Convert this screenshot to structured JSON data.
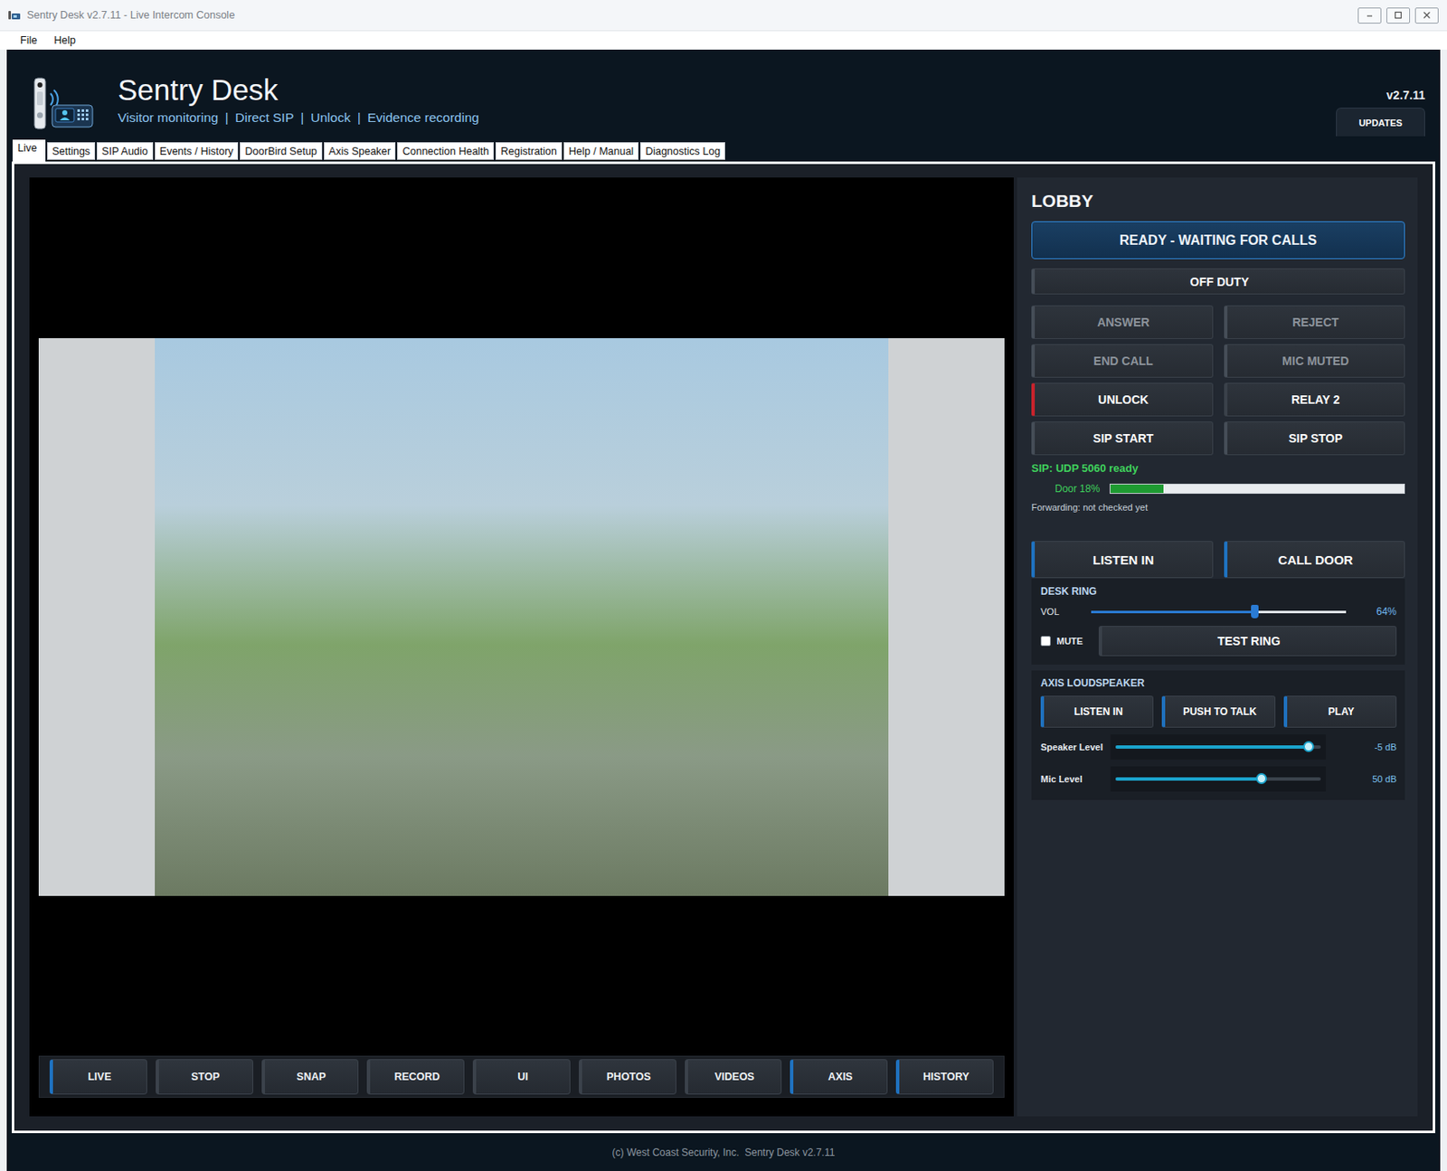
{
  "window": {
    "title": "Sentry Desk v2.7.11 - Live Intercom Console"
  },
  "menu": [
    {
      "label": "File"
    },
    {
      "label": "Help"
    }
  ],
  "header": {
    "title": "Sentry Desk",
    "subtitle": [
      "Visitor monitoring",
      "Direct SIP",
      "Unlock",
      "Evidence recording"
    ],
    "separator": "|",
    "version": "v2.7.11",
    "updates": "UPDATES"
  },
  "tabs": [
    {
      "label": "Live",
      "selected": true
    },
    {
      "label": "Settings",
      "selected": false
    },
    {
      "label": "SIP Audio",
      "selected": false
    },
    {
      "label": "Events / History",
      "selected": false
    },
    {
      "label": "DoorBird Setup",
      "selected": false
    },
    {
      "label": "Axis Speaker",
      "selected": false
    },
    {
      "label": "Connection Health",
      "selected": false
    },
    {
      "label": "Registration",
      "selected": false
    },
    {
      "label": "Help / Manual",
      "selected": false
    },
    {
      "label": "Diagnostics Log",
      "selected": false
    }
  ],
  "video": {
    "toolbar": [
      {
        "label": "LIVE",
        "accent": true
      },
      {
        "label": "STOP",
        "accent": false
      },
      {
        "label": "SNAP",
        "accent": false
      },
      {
        "label": "RECORD",
        "accent": false
      },
      {
        "label": "UI",
        "accent": false
      },
      {
        "label": "PHOTOS",
        "accent": false
      },
      {
        "label": "VIDEOS",
        "accent": false
      },
      {
        "label": "AXIS",
        "accent": true
      },
      {
        "label": "HISTORY",
        "accent": true
      }
    ]
  },
  "panel": {
    "title": "LOBBY",
    "status": "READY - WAITING FOR CALLS",
    "duty": "OFF DUTY",
    "controls": [
      {
        "label": "ANSWER",
        "disabled": true,
        "color": "#454d57"
      },
      {
        "label": "REJECT",
        "disabled": true,
        "color": "#454d57"
      },
      {
        "label": "END CALL",
        "disabled": true,
        "color": "#454d57"
      },
      {
        "label": "MIC MUTED",
        "disabled": true,
        "color": "#454d57"
      },
      {
        "label": "UNLOCK",
        "disabled": false,
        "color": "#c8232c"
      },
      {
        "label": "RELAY 2",
        "disabled": false,
        "color": "#3a414a"
      },
      {
        "label": "SIP START",
        "disabled": false,
        "color": "#454d57"
      },
      {
        "label": "SIP STOP",
        "disabled": false,
        "color": "#454d57"
      }
    ],
    "sip": "SIP: UDP 5060 ready",
    "door": {
      "label": "Door 18%",
      "level": 0.18
    },
    "forwarding": "Forwarding: not checked yet",
    "actions": [
      {
        "label": "LISTEN IN",
        "accent": true
      },
      {
        "label": "CALL DOOR",
        "accent": true
      }
    ],
    "desk_ring": {
      "title": "DESK RING",
      "volume": {
        "label": "VOL",
        "level": 0.64,
        "reading": "64%"
      },
      "mute": {
        "label": "MUTE",
        "checked": false
      },
      "test": "TEST RING"
    },
    "axis": {
      "title": "AXIS LOUDSPEAKER",
      "buttons": [
        {
          "label": "LISTEN IN",
          "accent": true
        },
        {
          "label": "PUSH TO TALK",
          "accent": true
        },
        {
          "label": "PLAY",
          "accent": true
        }
      ],
      "sliders": [
        {
          "label": "Speaker Level",
          "level": 0.94,
          "reading": "-5 dB"
        },
        {
          "label": "Mic Level",
          "level": 0.71,
          "reading": "50 dB"
        }
      ]
    }
  },
  "footer": "(c) West Coast Security, Inc.  Sentry Desk v2.7.11"
}
